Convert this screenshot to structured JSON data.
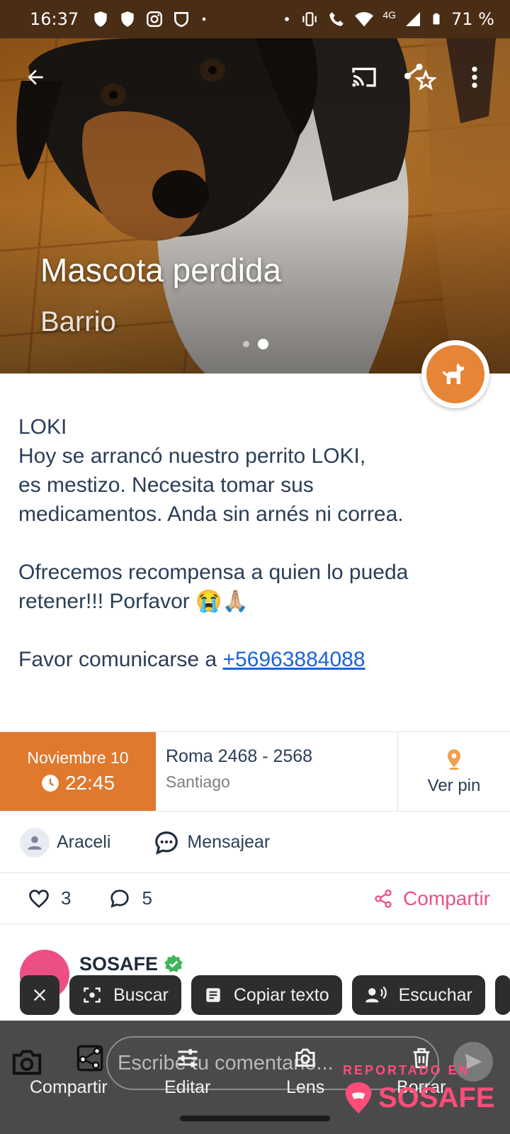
{
  "status_bar": {
    "time": "16:37",
    "network": "4G",
    "battery": "71 %"
  },
  "hero": {
    "title": "Mascota perdida",
    "subtitle": "Barrio",
    "carousel_count": 2,
    "carousel_active": 2
  },
  "post": {
    "lines": [
      "LOKI",
      "Hoy se arrancó nuestro perrito LOKI,",
      "es mestizo.  Necesita tomar sus",
      "medicamentos. Anda sin arnés ni correa.",
      "",
      "Ofrecemos recompensa a quien lo pueda",
      "retener!!! Porfavor 😭🙏🏼",
      ""
    ],
    "contact_prefix": "Favor comunicarse a ",
    "phone": "+56963884088"
  },
  "info": {
    "date": "Noviembre 10",
    "time": "22:45",
    "street": "Roma  2468 - 2568",
    "city": "Santiago",
    "pin_label": "Ver pin"
  },
  "author": {
    "name": "Araceli",
    "message_label": "Mensajear"
  },
  "reactions": {
    "likes": "3",
    "comments": "5",
    "share_label": "Compartir"
  },
  "comment": {
    "author": "SOSAFE"
  },
  "lens_chips": {
    "search": "Buscar",
    "copy_text": "Copiar texto",
    "listen": "Escuchar"
  },
  "bottom": {
    "comment_placeholder": "Escribe tu comentario...",
    "share": "Compartir",
    "edit": "Editar",
    "lens": "Lens",
    "delete": "Borrar",
    "reported_in": "REPORTADO EN",
    "brand": "SOSAFE"
  },
  "colors": {
    "accent_orange": "#e0782e",
    "brand_pink": "#ec4f86",
    "link_blue": "#1b63d8",
    "text_navy": "#2a3e56"
  },
  "icons": [
    "back-arrow-icon",
    "cast-icon",
    "share-star-icon",
    "more-vert-icon",
    "dog-icon",
    "clock-icon",
    "location-pin-icon",
    "person-icon",
    "chat-icon",
    "heart-icon",
    "comment-icon",
    "share-icon",
    "verified-icon",
    "close-icon",
    "lens-search-icon",
    "document-icon",
    "listen-icon",
    "camera-icon",
    "edit-icon",
    "lens-icon",
    "trash-icon",
    "send-icon"
  ]
}
